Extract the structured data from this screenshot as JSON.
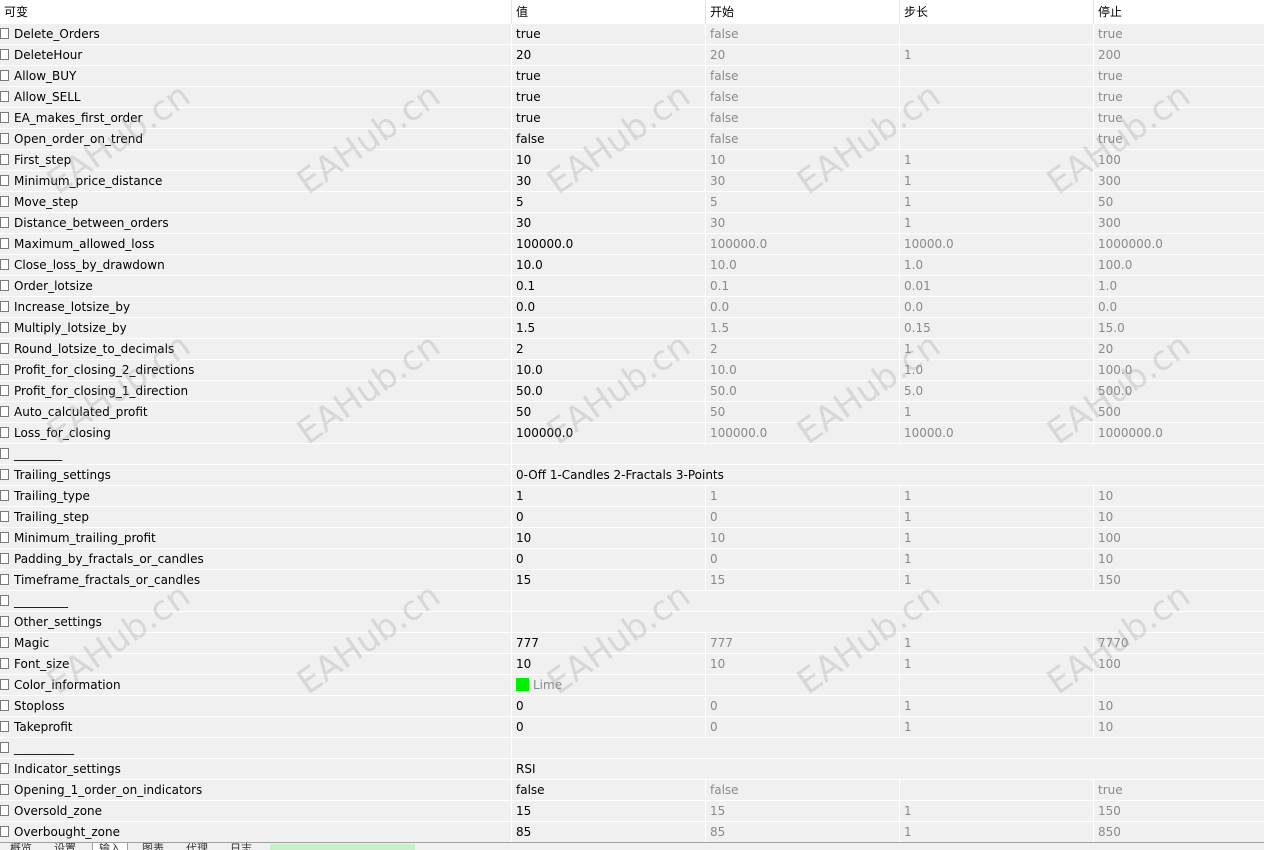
{
  "header": {
    "col_variable": "可变",
    "col_value": "值",
    "col_start": "开始",
    "col_step": "步长",
    "col_stop": "停止"
  },
  "rows": [
    {
      "name": "Delete_Orders",
      "value": "true",
      "start": "false",
      "step": "",
      "stop": "true"
    },
    {
      "name": "DeleteHour",
      "value": "20",
      "start": "20",
      "step": "1",
      "stop": "200"
    },
    {
      "name": "Allow_BUY",
      "value": "true",
      "start": "false",
      "step": "",
      "stop": "true"
    },
    {
      "name": "Allow_SELL",
      "value": "true",
      "start": "false",
      "step": "",
      "stop": "true"
    },
    {
      "name": "EA_makes_first_order",
      "value": "true",
      "start": "false",
      "step": "",
      "stop": "true"
    },
    {
      "name": "Open_order_on_trend",
      "value": "false",
      "start": "false",
      "step": "",
      "stop": "true"
    },
    {
      "name": "First_step",
      "value": "10",
      "start": "10",
      "step": "1",
      "stop": "100"
    },
    {
      "name": "Minimum_price_distance",
      "value": "30",
      "start": "30",
      "step": "1",
      "stop": "300"
    },
    {
      "name": "Move_step",
      "value": "5",
      "start": "5",
      "step": "1",
      "stop": "50"
    },
    {
      "name": "Distance_between_orders",
      "value": "30",
      "start": "30",
      "step": "1",
      "stop": "300"
    },
    {
      "name": "Maximum_allowed_loss",
      "value": "100000.0",
      "start": "100000.0",
      "step": "10000.0",
      "stop": "1000000.0"
    },
    {
      "name": "Close_loss_by_drawdown",
      "value": "10.0",
      "start": "10.0",
      "step": "1.0",
      "stop": "100.0"
    },
    {
      "name": "Order_lotsize",
      "value": "0.1",
      "start": "0.1",
      "step": "0.01",
      "stop": "1.0"
    },
    {
      "name": "Increase_lotsize_by",
      "value": "0.0",
      "start": "0.0",
      "step": "0.0",
      "stop": "0.0"
    },
    {
      "name": "Multiply_lotsize_by",
      "value": "1.5",
      "start": "1.5",
      "step": "0.15",
      "stop": "15.0"
    },
    {
      "name": "Round_lotsize_to_decimals",
      "value": "2",
      "start": "2",
      "step": "1",
      "stop": "20"
    },
    {
      "name": "Profit_for_closing_2_directions",
      "value": "10.0",
      "start": "10.0",
      "step": "1.0",
      "stop": "100.0"
    },
    {
      "name": "Profit_for_closing_1_direction",
      "value": "50.0",
      "start": "50.0",
      "step": "5.0",
      "stop": "500.0"
    },
    {
      "name": "Auto_calculated_profit",
      "value": "50",
      "start": "50",
      "step": "1",
      "stop": "500"
    },
    {
      "name": "Loss_for_closing",
      "value": "100000.0",
      "start": "100000.0",
      "step": "10000.0",
      "stop": "1000000.0"
    },
    {
      "name": "________",
      "value": "",
      "start": "",
      "step": "",
      "stop": "",
      "span": true
    },
    {
      "name": "Trailing_settings",
      "value": "0-Off  1-Candles  2-Fractals  3-Points",
      "start": "",
      "step": "",
      "stop": "",
      "span": true
    },
    {
      "name": "Trailing_type",
      "value": "1",
      "start": "1",
      "step": "1",
      "stop": "10"
    },
    {
      "name": "Trailing_step",
      "value": "0",
      "start": "0",
      "step": "1",
      "stop": "10"
    },
    {
      "name": "Minimum_trailing_profit",
      "value": "10",
      "start": "10",
      "step": "1",
      "stop": "100"
    },
    {
      "name": "Padding_by_fractals_or_candles",
      "value": "0",
      "start": "0",
      "step": "1",
      "stop": "10"
    },
    {
      "name": "Timeframe_fractals_or_candles",
      "value": "15",
      "start": "15",
      "step": "1",
      "stop": "150"
    },
    {
      "name": "_________",
      "value": "",
      "start": "",
      "step": "",
      "stop": "",
      "span": true
    },
    {
      "name": "Other_settings",
      "value": "",
      "start": "",
      "step": "",
      "stop": "",
      "span": true
    },
    {
      "name": "Magic",
      "value": "777",
      "start": "777",
      "step": "1",
      "stop": "7770"
    },
    {
      "name": "Font_size",
      "value": "10",
      "start": "10",
      "step": "1",
      "stop": "100"
    },
    {
      "name": "Color_information",
      "value": "",
      "color_name": "Lime",
      "color_hex": "#00ee00",
      "start": "",
      "step": "",
      "stop": ""
    },
    {
      "name": "Stoploss",
      "value": "0",
      "start": "0",
      "step": "1",
      "stop": "10"
    },
    {
      "name": "Takeprofit",
      "value": "0",
      "start": "0",
      "step": "1",
      "stop": "10"
    },
    {
      "name": "__________",
      "value": "",
      "start": "",
      "step": "",
      "stop": "",
      "span": true
    },
    {
      "name": "Indicator_settings",
      "value": "RSI",
      "start": "",
      "step": "",
      "stop": "",
      "span": true
    },
    {
      "name": "Opening_1_order_on_indicators",
      "value": "false",
      "start": "false",
      "step": "",
      "stop": "true"
    },
    {
      "name": "Oversold_zone",
      "value": "15",
      "start": "15",
      "step": "1",
      "stop": "150"
    },
    {
      "name": "Overbought_zone",
      "value": "85",
      "start": "85",
      "step": "1",
      "stop": "850"
    }
  ],
  "watermark": "EAHub.cn",
  "bottom_tabs": [
    "概览",
    "设置",
    "输入",
    "图表",
    "代理",
    "日志"
  ],
  "bottom_active_tab": 2
}
